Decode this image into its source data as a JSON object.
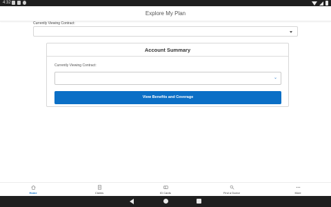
{
  "status_bar": {
    "time": "4:32"
  },
  "header": {
    "title": "Explore My Plan"
  },
  "top_select": {
    "label": "Currently Viewing Contract:",
    "value": ""
  },
  "account_summary": {
    "title": "Account Summary",
    "contract_label": "Currently Viewing Contract:",
    "contract_value": "",
    "primary_button": "View Benefits and Coverage"
  },
  "bottom_nav": {
    "items": [
      {
        "label": "Home",
        "icon": "home-icon",
        "active": true
      },
      {
        "label": "Claims",
        "icon": "claims-icon",
        "active": false
      },
      {
        "label": "ID Cards",
        "icon": "id-card-icon",
        "active": false
      },
      {
        "label": "Find a Doctor",
        "icon": "find-doctor-icon",
        "active": false
      },
      {
        "label": "More",
        "icon": "more-icon",
        "active": false
      }
    ]
  },
  "colors": {
    "accent": "#0b6fc6",
    "system_bar": "#1f1f1f"
  }
}
